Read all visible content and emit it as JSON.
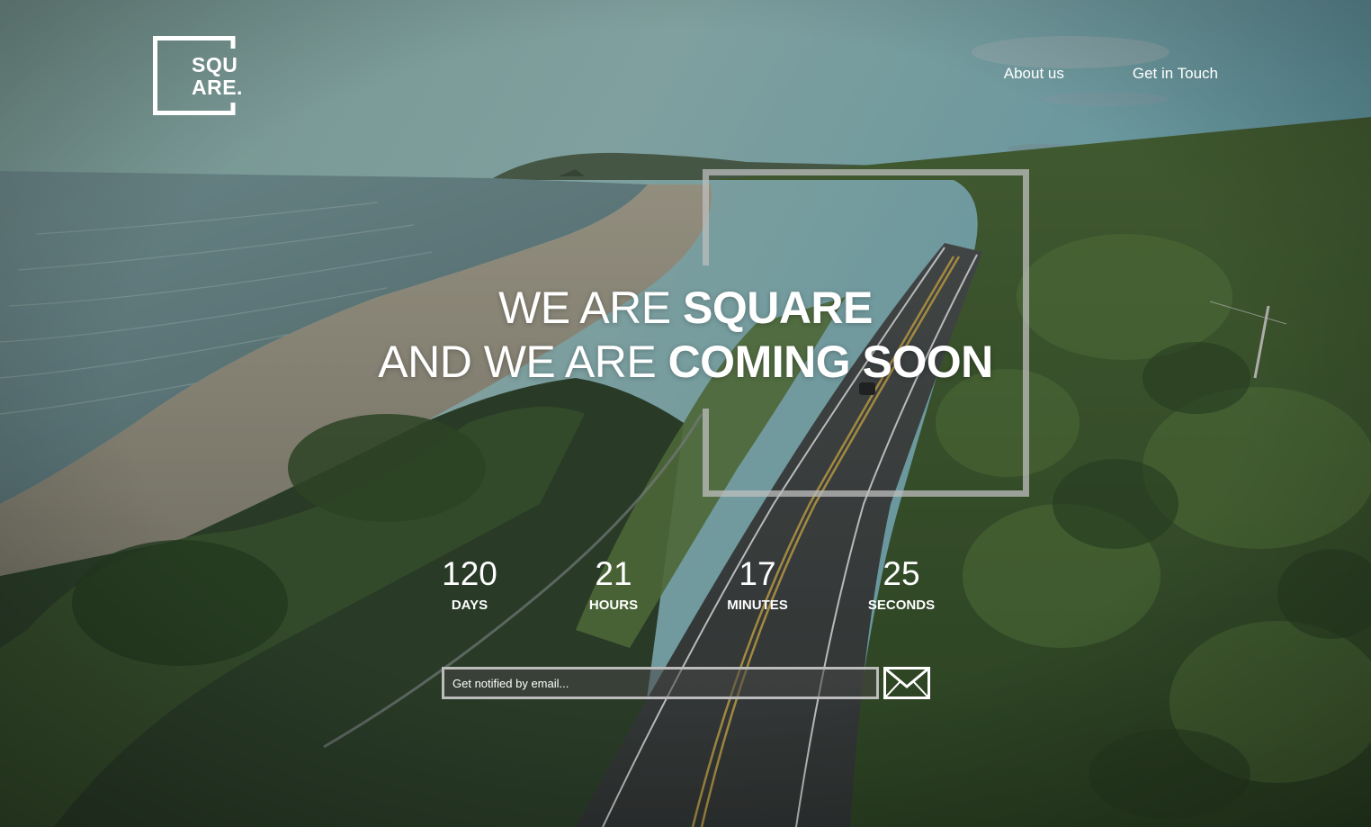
{
  "brand": {
    "logo_line1": "SQU",
    "logo_line2": "ARE."
  },
  "nav": {
    "items": [
      {
        "label": "About us"
      },
      {
        "label": "Get in Touch"
      }
    ]
  },
  "hero": {
    "line1_light": "WE ARE ",
    "line1_bold": "SQUARE",
    "line2_light": "AND WE ARE ",
    "line2_bold": "COMING SOON"
  },
  "countdown": [
    {
      "value": "120",
      "label": "DAYS"
    },
    {
      "value": "21",
      "label": "HOURS"
    },
    {
      "value": "17",
      "label": "MINUTES"
    },
    {
      "value": "25",
      "label": "SECONDS"
    }
  ],
  "subscribe": {
    "placeholder": "Get notified by email...",
    "send_icon": "envelope-icon"
  },
  "colors": {
    "text": "#ffffff",
    "frame": "#bdbdbd",
    "field_border": "#bcbcbc"
  }
}
